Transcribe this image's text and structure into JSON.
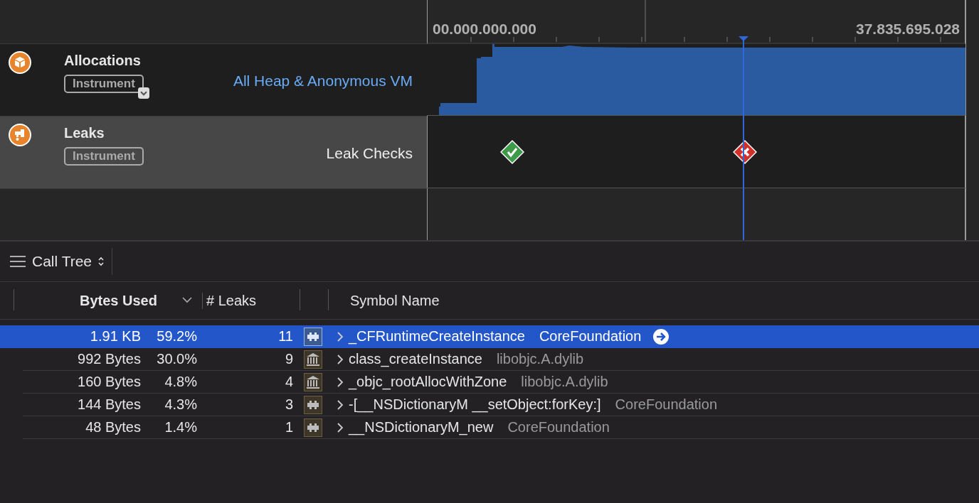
{
  "timeline": {
    "start_time": "00.000.000.000",
    "end_time": "37.835.695.028"
  },
  "tracks": [
    {
      "name": "Allocations",
      "badge": "Instrument",
      "kind": "allocations",
      "detail": "All Heap & Anonymous VM",
      "selected": false
    },
    {
      "name": "Leaks",
      "badge": "Instrument",
      "kind": "leaks",
      "detail": "Leak Checks",
      "selected": true
    }
  ],
  "leak_checks": [
    {
      "kind": "pass"
    },
    {
      "kind": "fail"
    }
  ],
  "toolbar": {
    "view_mode": "Call Tree"
  },
  "table": {
    "columns": [
      "Bytes Used",
      "# Leaks",
      "Symbol Name"
    ],
    "rows": [
      {
        "bytes": "1.91 KB",
        "percent": "59.2%",
        "leaks": "11",
        "kind": "framework",
        "symbol": "_CFRuntimeCreateInstance",
        "library": "CoreFoundation",
        "selected": true
      },
      {
        "bytes": "992 Bytes",
        "percent": "30.0%",
        "leaks": "9",
        "kind": "library",
        "symbol": "class_createInstance",
        "library": "libobjc.A.dylib",
        "selected": false
      },
      {
        "bytes": "160 Bytes",
        "percent": "4.8%",
        "leaks": "4",
        "kind": "library",
        "symbol": "_objc_rootAllocWithZone",
        "library": "libobjc.A.dylib",
        "selected": false
      },
      {
        "bytes": "144 Bytes",
        "percent": "4.3%",
        "leaks": "3",
        "kind": "framework",
        "symbol": "-[__NSDictionaryM __setObject:forKey:]",
        "library": "CoreFoundation",
        "selected": false
      },
      {
        "bytes": "48 Bytes",
        "percent": "1.4%",
        "leaks": "1",
        "kind": "framework",
        "symbol": "__NSDictionaryM_new",
        "library": "CoreFoundation",
        "selected": false
      }
    ]
  }
}
